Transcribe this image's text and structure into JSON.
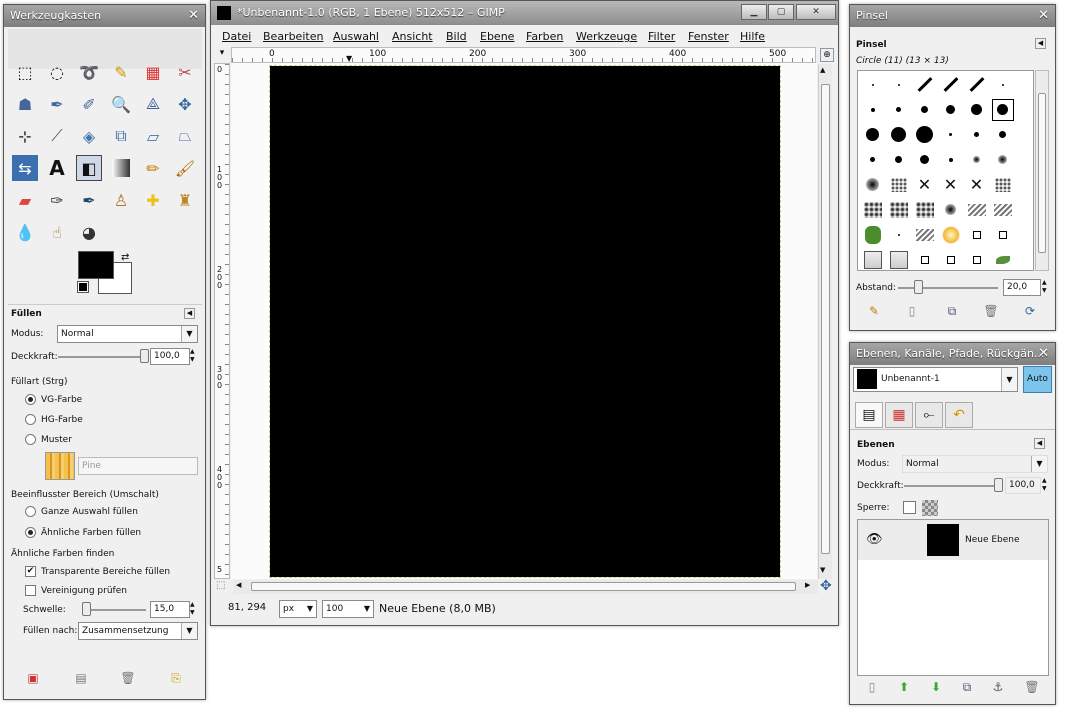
{
  "toolbox": {
    "title": "Werkzeugkasten",
    "options_title": "Füllen",
    "mode_label": "Modus:",
    "mode_value": "Normal",
    "opacity_label": "Deckkraft:",
    "opacity_value": "100,0",
    "opacity_level": 1.0,
    "fill_type_label": "Füllart  (Strg)",
    "fill_types": [
      "VG-Farbe",
      "HG-Farbe",
      "Muster"
    ],
    "fill_type_selected": 0,
    "pattern_name": "Pine",
    "affected_area_label": "Beeinflusster Bereich (Umschalt)",
    "affected_areas": [
      "Ganze Auswahl füllen",
      "Ähnliche Farben füllen"
    ],
    "affected_area_selected": 1,
    "similar_label": "Ähnliche Farben finden",
    "transparent_label": "Transparente Bereiche füllen",
    "transparent_checked": true,
    "merge_label": "Vereinigung prüfen",
    "merge_checked": false,
    "threshold_label": "Schwelle:",
    "threshold_value": "15,0",
    "threshold_level": 0.06,
    "fill_by_label": "Füllen nach:",
    "fill_by_value": "Zusammensetzung",
    "fg_color": "#000000",
    "bg_color": "#ffffff"
  },
  "main": {
    "title": "*Unbenannt-1.0 (RGB, 1 Ebene) 512x512 – GIMP",
    "menus": [
      "Datei",
      "Bearbeiten",
      "Auswahl",
      "Ansicht",
      "Bild",
      "Ebene",
      "Farben",
      "Werkzeuge",
      "Filter",
      "Fenster",
      "Hilfe"
    ],
    "ruler_h": [
      "0",
      "100",
      "200",
      "300",
      "400",
      "500"
    ],
    "ruler_v": [
      "0",
      "1\n0\n0",
      "2\n0\n0",
      "3\n0\n0",
      "4\n0\n0",
      "5"
    ],
    "coords": "81, 294",
    "unit": "px",
    "zoom": "100",
    "status": "Neue Ebene (8,0 MB)",
    "win_buttons": [
      "minimize",
      "maximize",
      "close"
    ]
  },
  "pinsel": {
    "title": "Pinsel",
    "panel_title": "Pinsel",
    "brush_name": "Circle (11) (13 × 13)",
    "spacing_label": "Abstand:",
    "spacing_value": "20,0",
    "spacing_level": 0.2
  },
  "layers": {
    "title": "Ebenen, Kanäle, Pfade, Rückgän...",
    "image_name": "Unbenannt-1",
    "auto_label": "Auto",
    "panel_title": "Ebenen",
    "mode_label": "Modus:",
    "mode_value": "Normal",
    "opacity_label": "Deckkraft:",
    "opacity_value": "100,0",
    "opacity_level": 1.0,
    "lock_label": "Sperre:",
    "layer_name": "Neue Ebene"
  }
}
